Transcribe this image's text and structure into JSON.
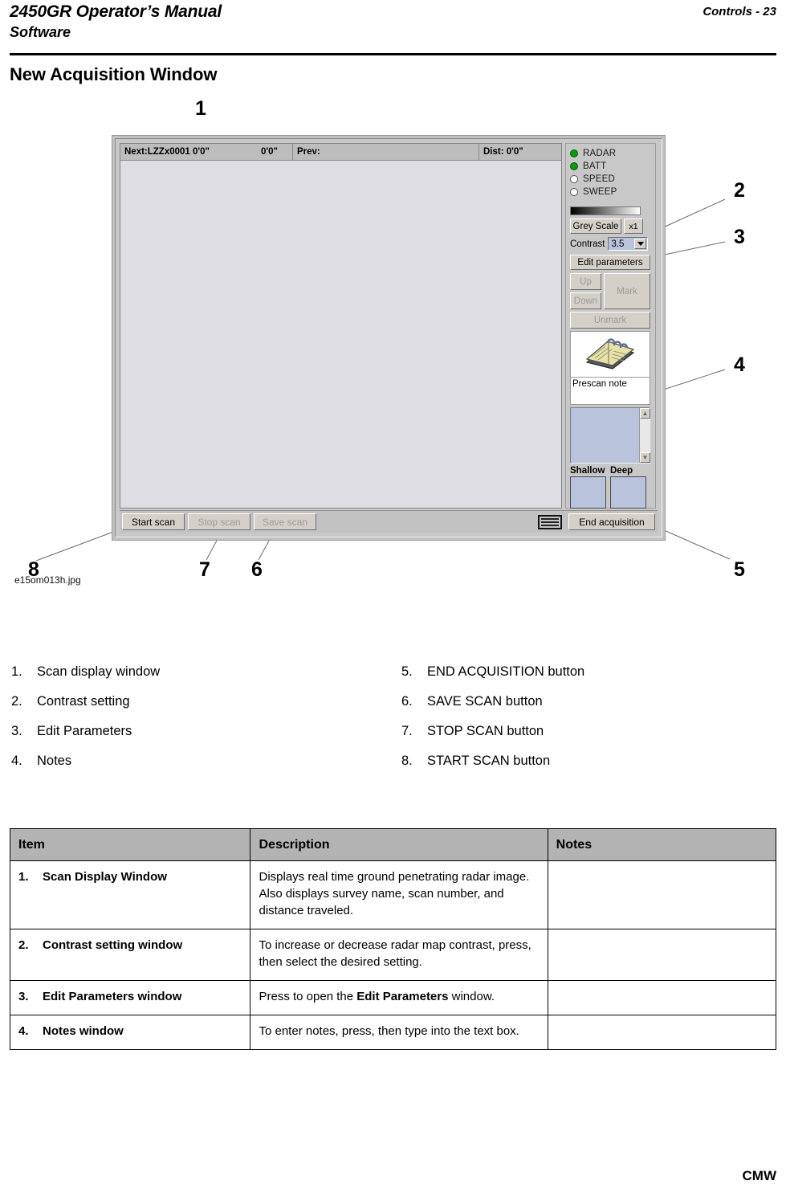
{
  "header": {
    "title": "2450GR Operator’s Manual",
    "subtitle": "Software",
    "right": "Controls - 23"
  },
  "section": {
    "heading": "New Acquisition Window"
  },
  "figure": {
    "caption": "e15om013h.jpg",
    "callouts": [
      "1",
      "2",
      "3",
      "4",
      "5",
      "6",
      "7",
      "8"
    ]
  },
  "app": {
    "infobar": {
      "next": "Next:LZZx0001  0'0\"",
      "scan_number": "0'0\"",
      "prev": "Prev:",
      "dist": "Dist:  0'0\""
    },
    "leds": [
      {
        "label": "RADAR",
        "state": "on"
      },
      {
        "label": "BATT",
        "state": "on"
      },
      {
        "label": "SPEED",
        "state": "off"
      },
      {
        "label": "SWEEP",
        "state": "off"
      }
    ],
    "grey_scale_button": "Grey Scale",
    "zoom_button": "x1",
    "contrast_label": "Contrast",
    "contrast_value": "3.5",
    "edit_parameters_button": "Edit parameters",
    "up_button": "Up",
    "down_button": "Down",
    "mark_button": "Mark",
    "unmark_button": "Unmark",
    "prescan_note_label": "Prescan note",
    "notes_text": "",
    "shallow_label": "Shallow",
    "deep_label": "Deep",
    "toolbar": {
      "start_scan": "Start scan",
      "stop_scan": "Stop scan",
      "save_scan": "Save scan",
      "end_acquisition": "End acquisition"
    },
    "colors": {
      "led_on": "#0a9b0a",
      "led_off": "#fdfdfd",
      "scan_canvas": "#dedde3",
      "panel": "#c8c8c8",
      "field": "#b9c3dc"
    }
  },
  "legend": {
    "left": [
      {
        "num": "1.",
        "label": "Scan display window"
      },
      {
        "num": "2.",
        "label": "Contrast setting"
      },
      {
        "num": "3.",
        "label": "Edit Parameters"
      },
      {
        "num": "4.",
        "label": "Notes"
      }
    ],
    "right": [
      {
        "num": "5.",
        "label": "END ACQUISITION button"
      },
      {
        "num": "6.",
        "label": "SAVE SCAN button"
      },
      {
        "num": "7.",
        "label": "STOP SCAN button"
      },
      {
        "num": "8.",
        "label": "START SCAN button"
      }
    ]
  },
  "table": {
    "headers": [
      "Item",
      "Description",
      "Notes"
    ],
    "rows": [
      {
        "num": "1.",
        "item": "Scan Display Window",
        "desc_pre": "Displays real time ground penetrating radar image. Also displays survey name, scan number, and distance traveled.",
        "desc_bold": "",
        "desc_post": "",
        "notes": ""
      },
      {
        "num": "2.",
        "item": "Contrast setting window",
        "desc_pre": "To increase or decrease radar map contrast, press, then select the desired setting.",
        "desc_bold": "",
        "desc_post": "",
        "notes": ""
      },
      {
        "num": "3.",
        "item": "Edit Parameters window",
        "desc_pre": "Press to open the ",
        "desc_bold": "Edit Parameters",
        "desc_post": " window.",
        "notes": ""
      },
      {
        "num": "4.",
        "item": "Notes window",
        "desc_pre": "To enter notes, press, then type into the text box.",
        "desc_bold": "",
        "desc_post": "",
        "notes": ""
      }
    ]
  },
  "footer": {
    "text": "CMW"
  }
}
